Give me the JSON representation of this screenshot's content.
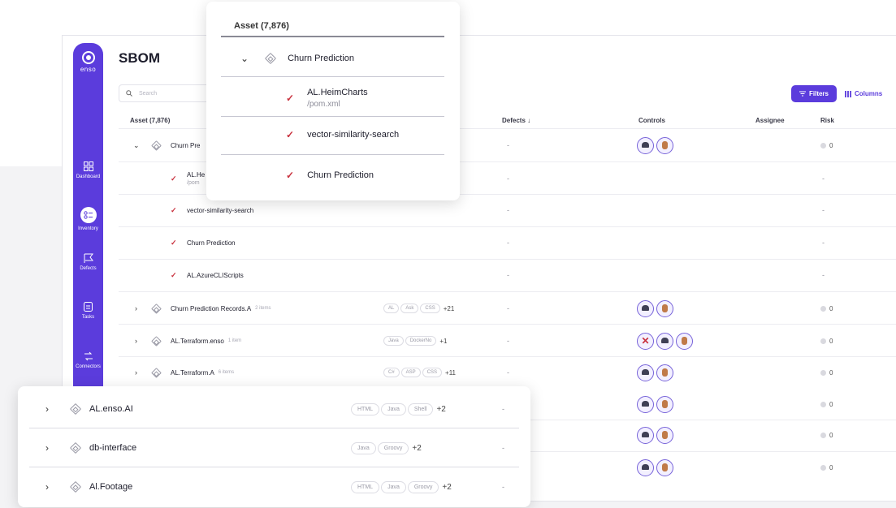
{
  "app": {
    "logo_text": "enso",
    "title": "SBOM",
    "search_placeholder": "Search",
    "filters_label": "Filters",
    "columns_label": "Columns"
  },
  "sidebar": {
    "items": [
      {
        "label": "Dashboard",
        "icon": "grid-icon"
      },
      {
        "label": "Inventory",
        "icon": "inventory-icon"
      },
      {
        "label": "Defects",
        "icon": "flag-icon"
      },
      {
        "label": "Tasks",
        "icon": "clipboard-icon"
      },
      {
        "label": "Connectors",
        "icon": "connectors-icon"
      }
    ]
  },
  "table": {
    "headers": {
      "asset": "Asset (7,876)",
      "defects": "Defects ↓",
      "controls": "Controls",
      "assignee": "Assignee",
      "risk": "Risk"
    },
    "rows": [
      {
        "name": "Churn Pre",
        "defects": "-",
        "risk": "0"
      },
      {
        "name": "AL.He",
        "path": "/pom",
        "defects": "-",
        "risk": "-"
      },
      {
        "name": "vector-similarity-search",
        "defects": "-",
        "risk": "-"
      },
      {
        "name": "Churn Prediction",
        "defects": "-",
        "risk": "-"
      },
      {
        "name": "AL.AzureCLIScripts",
        "defects": "-",
        "risk": "-"
      },
      {
        "name": "Churn Prediction Records.A",
        "sub": "2 items",
        "pills": [
          "AL",
          "Ask",
          "CSS"
        ],
        "more": "+21",
        "defects": "-",
        "risk": "0"
      },
      {
        "name": "AL.Terraform.enso",
        "sub": "1 item",
        "pills": [
          "Java",
          "DockerNo"
        ],
        "more": "+1",
        "defects": "-",
        "risk": "0"
      },
      {
        "name": "AL.Terraform.A",
        "sub": "6 items",
        "pills": [
          "C#",
          "ASP",
          "CSS"
        ],
        "more": "+11",
        "defects": "-",
        "risk": "0"
      },
      {
        "risk": "0"
      },
      {
        "risk": "0"
      },
      {
        "risk": "0"
      }
    ]
  },
  "popup": {
    "header": "Asset (7,876)",
    "parent": "Churn Prediction",
    "items": [
      {
        "name": "AL.HeimCharts",
        "path": "/pom.xml"
      },
      {
        "name": "vector-similarity-search"
      },
      {
        "name": "Churn Prediction"
      }
    ]
  },
  "bottom_panel": {
    "rows": [
      {
        "name": "AL.enso.AI",
        "pills": [
          "HTML",
          "Java",
          "Shell"
        ],
        "more": "+2",
        "defects": "-"
      },
      {
        "name": "db-interface",
        "pills": [
          "Java",
          "Groovy"
        ],
        "more": "+2",
        "defects": "-"
      },
      {
        "name": "Al.Footage",
        "pills": [
          "HTML",
          "Java",
          "Groovy"
        ],
        "more": "+2",
        "defects": "-"
      }
    ]
  },
  "colors": {
    "accent": "#5b3cdc",
    "check": "#c8303d"
  }
}
